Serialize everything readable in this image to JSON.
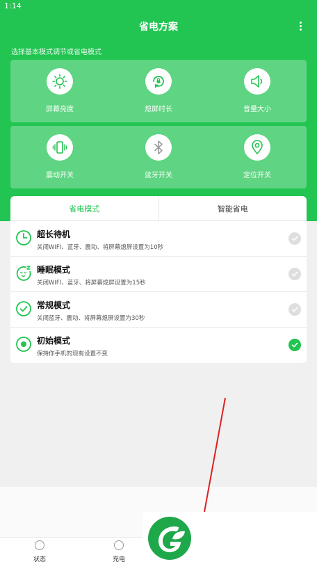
{
  "status": {
    "time": "1:14"
  },
  "header": {
    "title": "省电方案"
  },
  "hint": "选择基本模式调节或省电模式",
  "tiles": [
    {
      "label": "屏幕亮度",
      "icon": "sun-icon"
    },
    {
      "label": "熄屏时长",
      "icon": "screen-timeout-icon"
    },
    {
      "label": "音量大小",
      "icon": "speaker-icon"
    },
    {
      "label": "震动开关",
      "icon": "vibrate-icon"
    },
    {
      "label": "蓝牙开关",
      "icon": "bluetooth-icon"
    },
    {
      "label": "定位开关",
      "icon": "location-icon"
    }
  ],
  "tabs": [
    {
      "label": "省电模式",
      "active": true
    },
    {
      "label": "智能省电",
      "active": false
    }
  ],
  "modes": [
    {
      "title": "超长待机",
      "desc": "关闭WIFI、蓝牙、震动、将屏幕熄屏设置为10秒",
      "selected": false,
      "icon": "clock-icon"
    },
    {
      "title": "睡眠模式",
      "desc": "关闭WIFI、蓝牙、将屏幕熄屏设置为15秒",
      "selected": false,
      "icon": "sleep-face-icon"
    },
    {
      "title": "常规模式",
      "desc": "关闭蓝牙、震动、将屏幕熄屏设置为30秒",
      "selected": false,
      "icon": "check-circle-icon"
    },
    {
      "title": "初始模式",
      "desc": "保持你手机的现有设置不变",
      "selected": true,
      "icon": "radio-dot-icon"
    }
  ],
  "nav": [
    {
      "label": "状态"
    },
    {
      "label": "充电"
    }
  ],
  "colors": {
    "accent": "#22c452",
    "check_off": "#dedede"
  }
}
